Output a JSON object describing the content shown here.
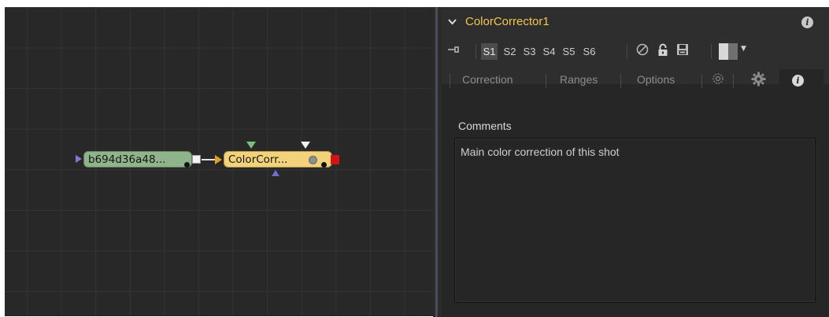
{
  "node_editor": {
    "nodes": [
      {
        "label": "b694d36a48...",
        "color": "#8fb38a"
      },
      {
        "label": "ColorCorr...",
        "color": "#f2d27a"
      }
    ]
  },
  "inspector": {
    "title": "ColorCorrector1",
    "toolbar": {
      "slots": [
        "S1",
        "S2",
        "S3",
        "S4",
        "S5",
        "S6"
      ],
      "active_slot": "S1",
      "icons": [
        "pin-icon",
        "no-entry-icon",
        "lock-icon",
        "save-icon",
        "swatch-dropdown"
      ]
    },
    "tabs": [
      {
        "label": "Correction"
      },
      {
        "label": "Ranges"
      },
      {
        "label": "Options"
      }
    ],
    "tab_icons": [
      "gear-settings-icon",
      "settings-icon",
      "info-icon"
    ],
    "active_tab": "info-icon",
    "comments": {
      "label": "Comments",
      "value": "Main color correction of this shot"
    },
    "accent_color": "#f3c64d"
  }
}
